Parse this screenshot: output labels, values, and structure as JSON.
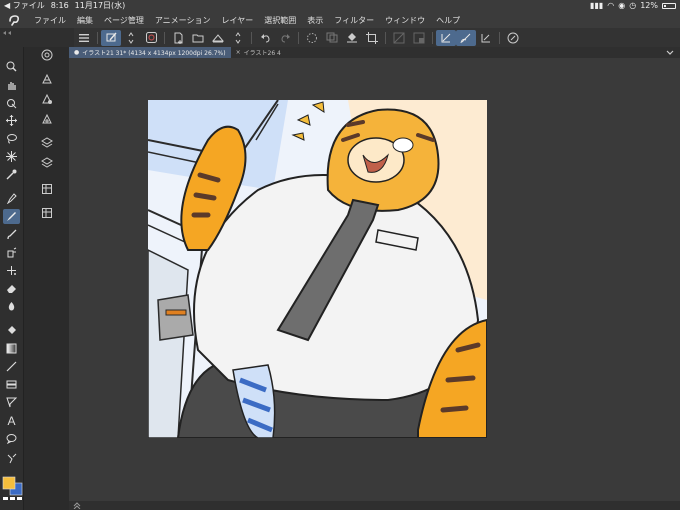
{
  "status": {
    "carrier": "ファイル",
    "time": "8:16",
    "date": "11月17日(水)",
    "battery": "12%"
  },
  "menu": [
    "ファイル",
    "編集",
    "ページ管理",
    "アニメーション",
    "レイヤー",
    "選択範囲",
    "表示",
    "フィルター",
    "ウィンドウ",
    "ヘルプ"
  ],
  "tabs": {
    "active": "イラスト21 31* (4134 x 4134px 1200dpi 26.7%)",
    "second": "イラスト26 4"
  },
  "colors": {
    "main": "#f5be3c",
    "sub": "#3b6bc4"
  }
}
